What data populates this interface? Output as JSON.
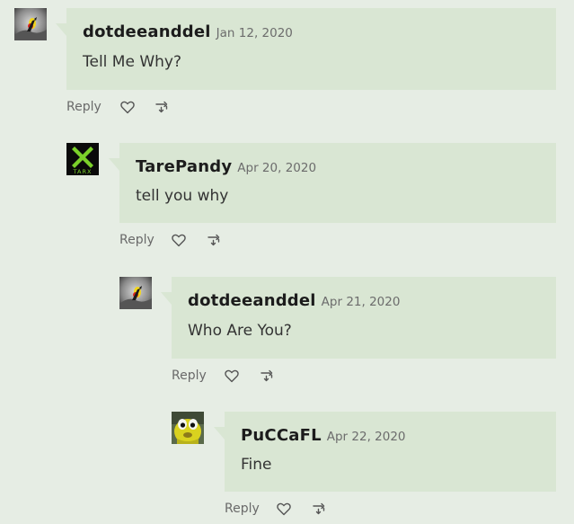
{
  "comments": [
    {
      "author": "dotdeeanddel",
      "date": "Jan 12, 2020",
      "text": "Tell Me Why?",
      "avatar_icon": "rock-bird-avatar-icon",
      "reply_label": "Reply"
    },
    {
      "author": "TarePandy",
      "date": "Apr 20, 2020",
      "text": "tell you why",
      "avatar_icon": "xbox-tarx-avatar-icon",
      "avatar_caption": "TARX",
      "reply_label": "Reply"
    },
    {
      "author": "dotdeeanddel",
      "date": "Apr 21, 2020",
      "text": "Who Are You?",
      "avatar_icon": "rock-bird-avatar-icon",
      "reply_label": "Reply"
    },
    {
      "author": "PuCCaFL",
      "date": "Apr 22, 2020",
      "text": "Fine",
      "avatar_icon": "yellow-bird-avatar-icon",
      "reply_label": "Reply"
    }
  ],
  "icons": {
    "like": "heart-icon",
    "share": "repost-icon"
  },
  "colors": {
    "page_background": "#e6ede4",
    "bubble_background": "#d9e6d3",
    "author_text": "#1c1c1c",
    "date_text": "#6c6c6c",
    "xbox_green": "#7bd12a"
  }
}
